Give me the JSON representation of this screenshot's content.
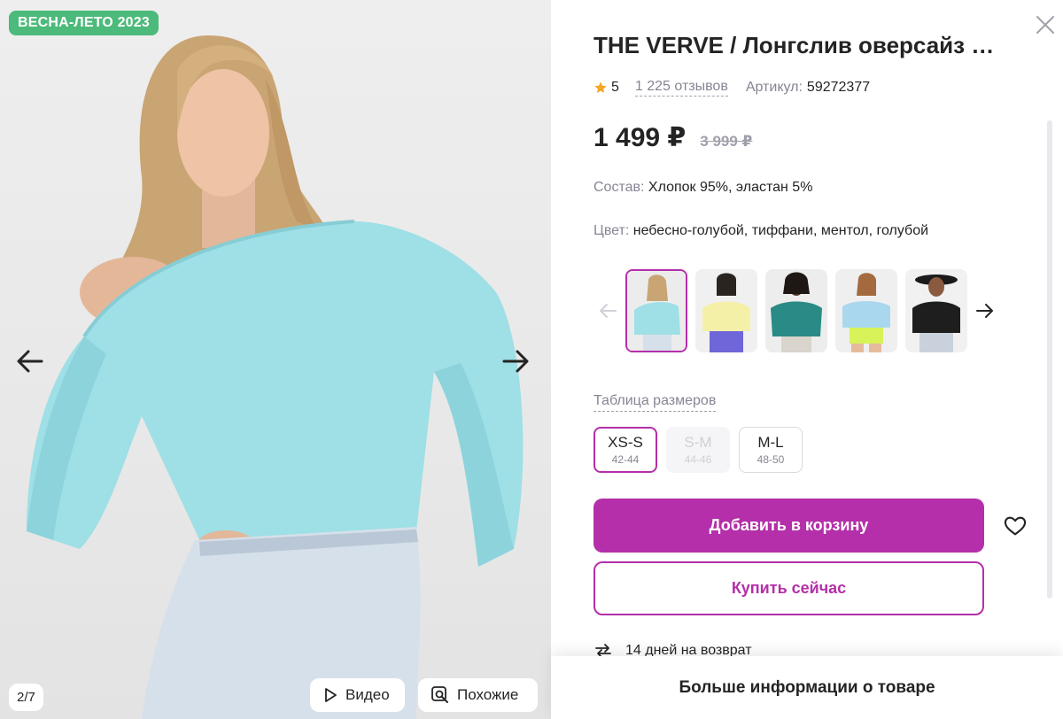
{
  "photo": {
    "season_badge": "ВЕСНА-ЛЕТО 2023",
    "counter": "2/7",
    "video_label": "Видео",
    "similar_label": "Похожие"
  },
  "product": {
    "title": "THE VERVE / Лонгслив оверсайз …",
    "rating": "5",
    "reviews": "1 225 отзывов",
    "article_label": "Артикул:",
    "article_value": "59272377",
    "price": "1 499 ₽",
    "old_price": "3 999 ₽",
    "composition_label": "Состав:",
    "composition_value": "Хлопок 95%, эластан 5%",
    "color_label": "Цвет:",
    "color_value": "небесно-голубой, тиффани, ментол, голубой"
  },
  "size_table_link": "Таблица размеров",
  "sizes": [
    {
      "size": "XS-S",
      "range": "42-44",
      "state": "selected"
    },
    {
      "size": "S-M",
      "range": "44-46",
      "state": "disabled"
    },
    {
      "size": "M-L",
      "range": "48-50",
      "state": "available"
    }
  ],
  "actions": {
    "add_to_cart": "Добавить в корзину",
    "buy_now": "Купить сейчас",
    "return_policy": "14 дней на возврат",
    "more_info": "Больше информации о товаре"
  },
  "colors": {
    "accent": "#b42fa9",
    "badge": "#4cba7a",
    "star": "#f6a623",
    "muted": "#868695"
  }
}
